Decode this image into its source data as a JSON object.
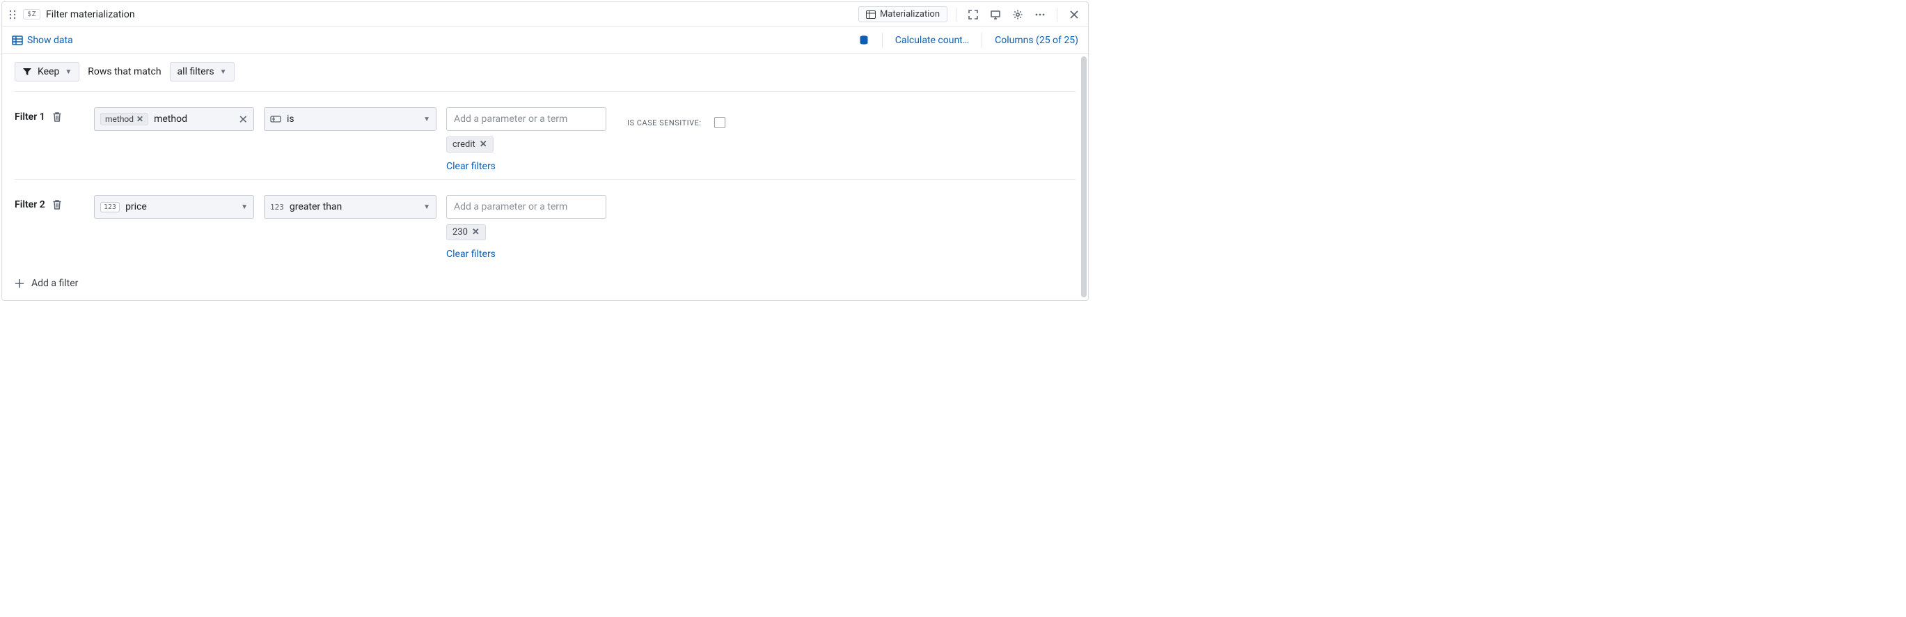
{
  "header": {
    "var_badge": "$Z",
    "title": "Filter materialization",
    "materialization_btn": "Materialization"
  },
  "subheader": {
    "show_data": "Show data",
    "calculate_counts": "Calculate count…",
    "columns": "Columns (25 of 25)"
  },
  "keep_row": {
    "keep": "Keep",
    "rows_that_match": "Rows that match",
    "all_filters": "all filters"
  },
  "filters": [
    {
      "label": "Filter 1",
      "column_chip": "method",
      "column_text": "method",
      "operator": "is",
      "value_placeholder": "Add a parameter or a term",
      "value_chip": "credit",
      "clear": "Clear filters",
      "case_label": "IS CASE SENSITIVE:"
    },
    {
      "label": "Filter 2",
      "column_type_badge": "123",
      "column_text": "price",
      "operator_type_badge": "123",
      "operator": "greater than",
      "value_placeholder": "Add a parameter or a term",
      "value_chip": "230",
      "clear": "Clear filters"
    }
  ],
  "add_filter": "Add a filter"
}
